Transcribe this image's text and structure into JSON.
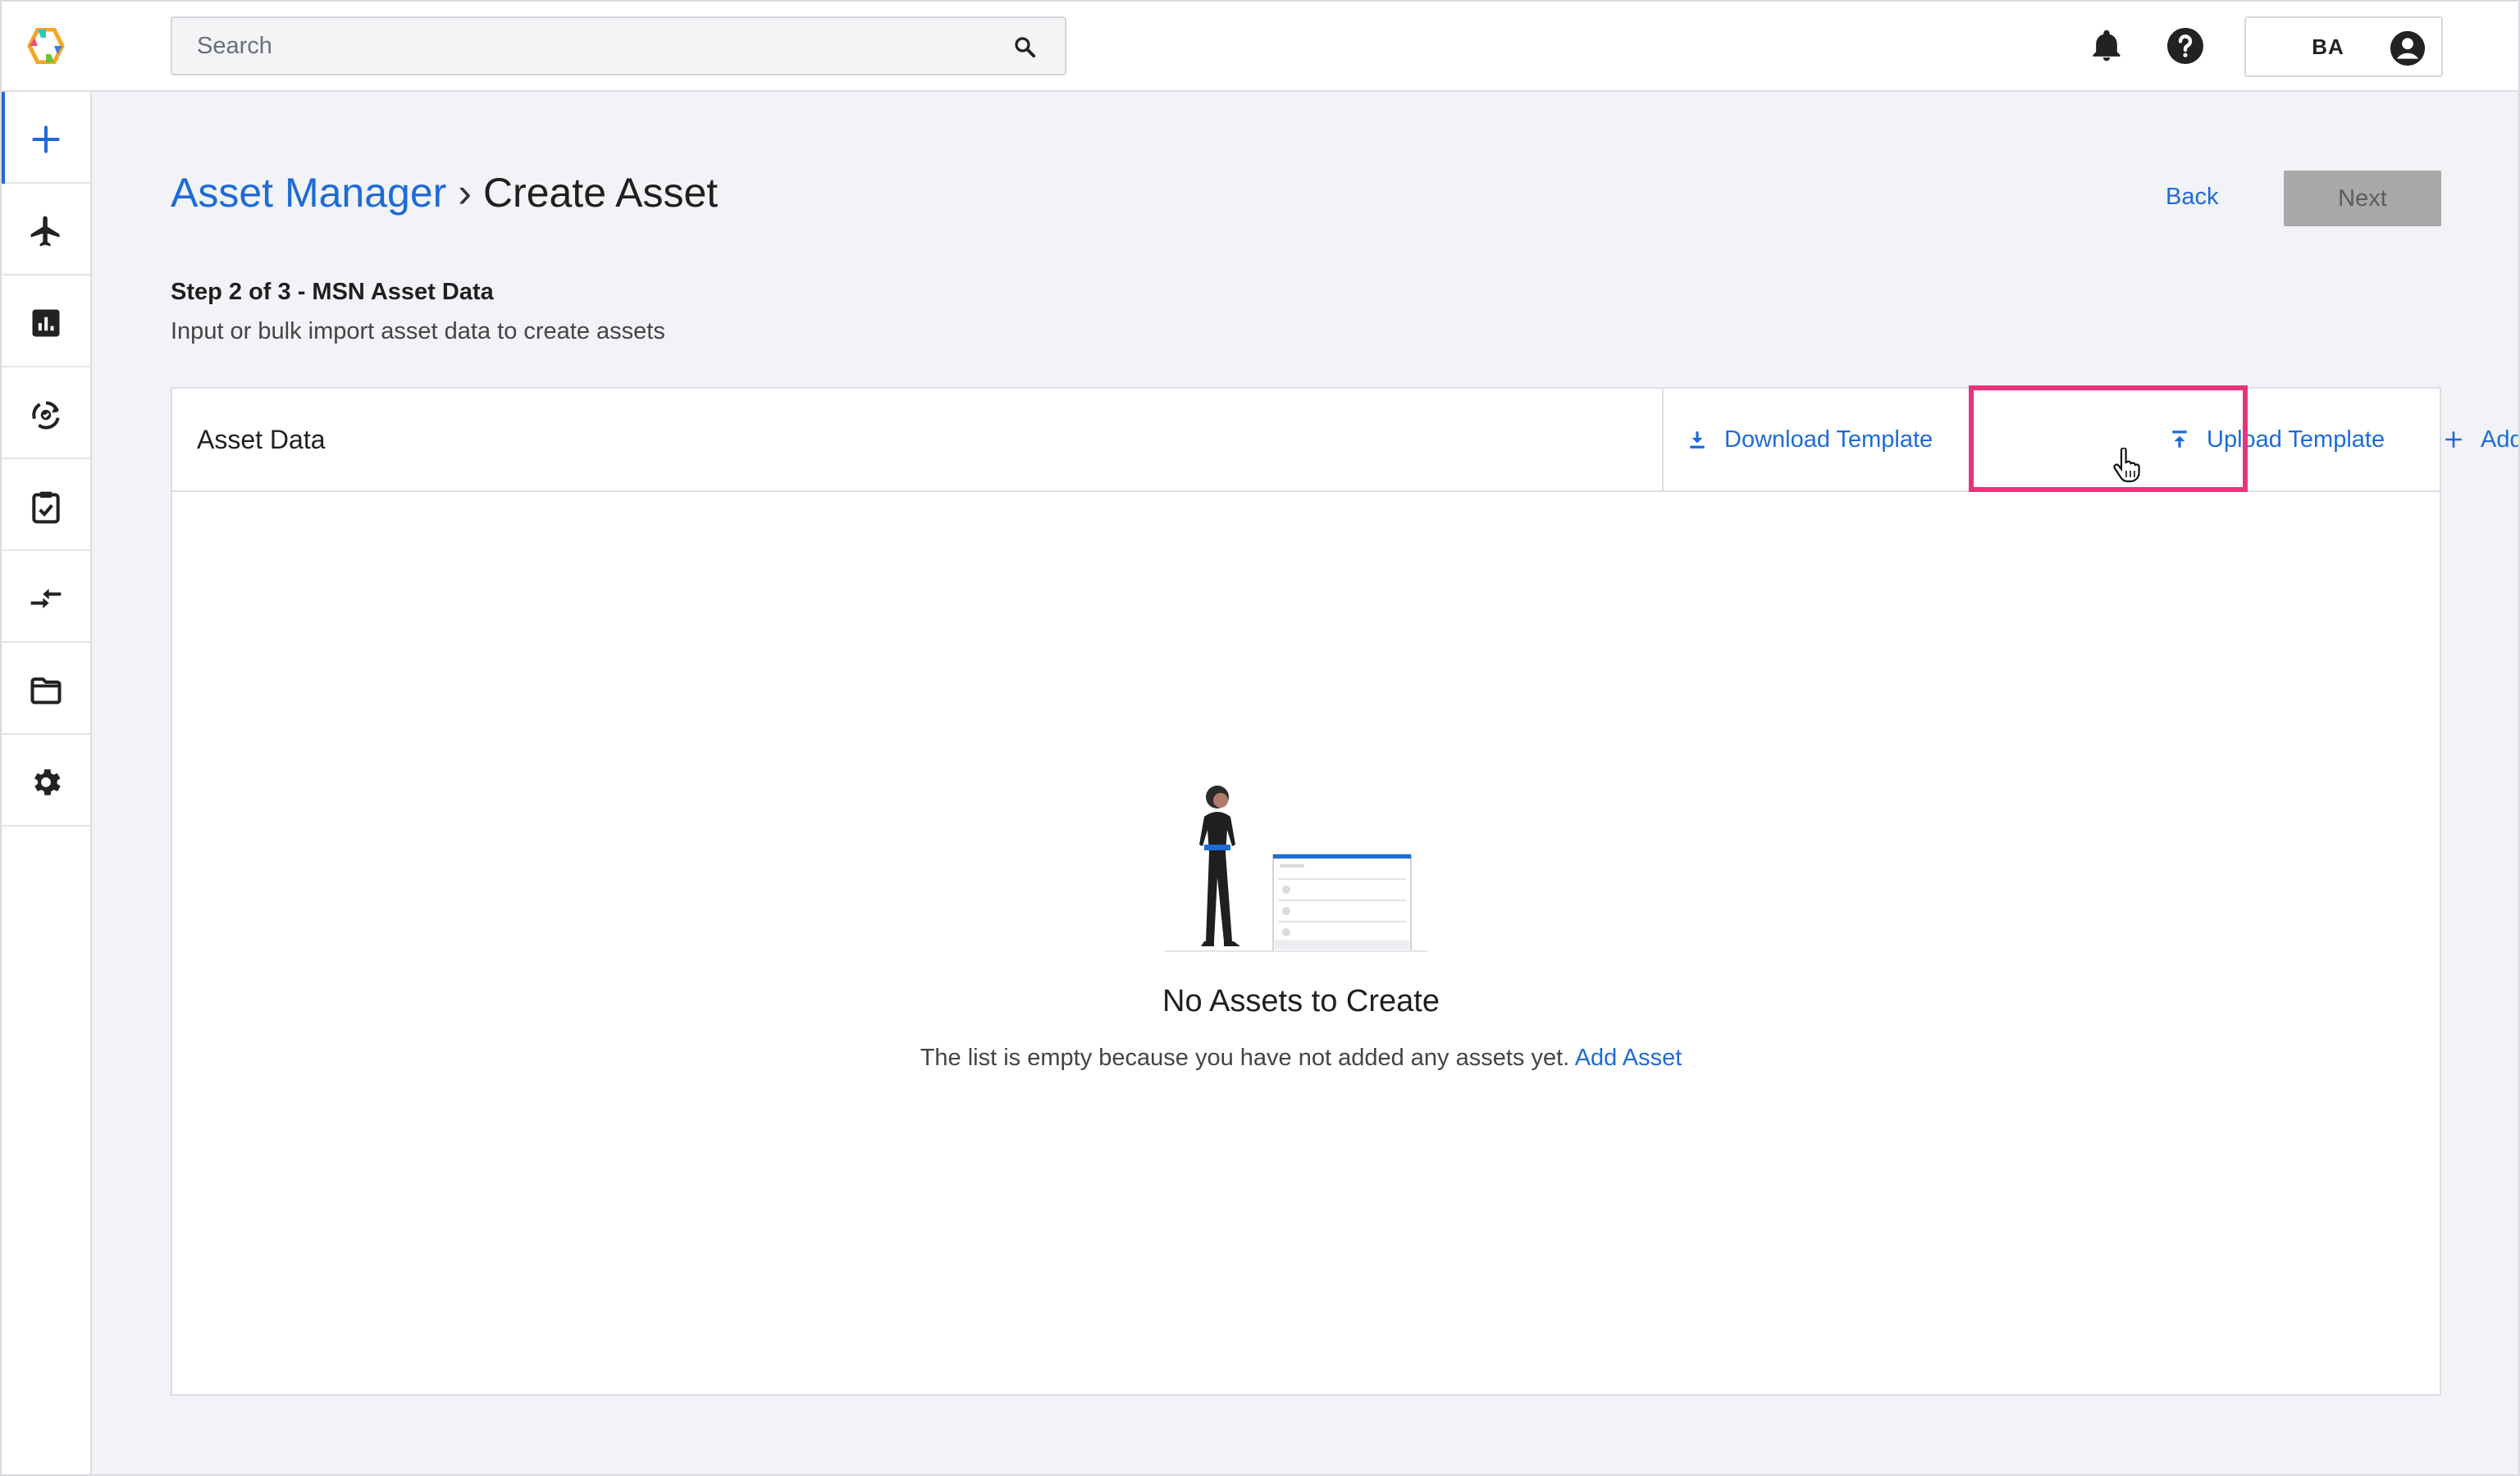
{
  "topbar": {
    "search_placeholder": "Search",
    "user_initials": "BA",
    "icons": [
      "app-logo-icon",
      "search-icon",
      "bell-icon",
      "help-icon",
      "account-icon"
    ]
  },
  "sidebar": {
    "items": [
      {
        "name": "create",
        "icon": "plus-icon",
        "active": true
      },
      {
        "name": "aircraft",
        "icon": "airplane-icon",
        "active": false
      },
      {
        "name": "reports",
        "icon": "chart-icon",
        "active": false
      },
      {
        "name": "maintenance",
        "icon": "cycle-icon",
        "active": false
      },
      {
        "name": "tasks",
        "icon": "clipboard-check-icon",
        "active": false
      },
      {
        "name": "transfers",
        "icon": "swap-arrows-icon",
        "active": false
      },
      {
        "name": "files",
        "icon": "folder-icon",
        "active": false
      },
      {
        "name": "settings",
        "icon": "gear-icon",
        "active": false
      }
    ]
  },
  "page": {
    "breadcrumb_parent": "Asset Manager",
    "breadcrumb_sep": "›",
    "breadcrumb_current": "Create Asset",
    "back_label": "Back",
    "next_label": "Next",
    "step_title": "Step 2 of 3 - MSN Asset Data",
    "step_subtitle": "Input or bulk import asset data to create assets"
  },
  "card": {
    "title": "Asset Data",
    "download_label": "Download Template",
    "upload_label": "Upload Template",
    "add_label": "Add Asset",
    "empty_title": "No Assets to Create",
    "empty_text": "The list is empty because you have not added any assets yet.",
    "empty_link": "Add Asset"
  },
  "colors": {
    "accent": "#1e6bd6",
    "highlight": "#e8347a",
    "disabled_button": "#a9a9a9"
  }
}
